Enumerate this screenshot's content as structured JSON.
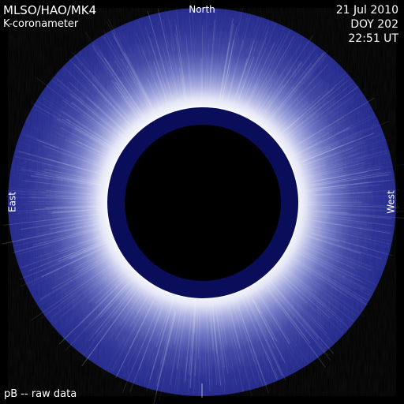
{
  "header": {
    "instrument": "MLSO/HAO/MK4",
    "instrument_type": "K-coronameter",
    "date": "21 Jul 2010",
    "doy": "DOY 202",
    "time": "22:51 UT"
  },
  "orientation": {
    "north": "North",
    "east": "East",
    "west": "West"
  },
  "footer": {
    "caption": "pB -- raw data"
  },
  "colors": {
    "background": "#000000",
    "outer_corona": "#232a8e",
    "bright_corona": "#ffffff",
    "occulter_ring": "#0a0e5a",
    "occulter_core": "#000000",
    "text": "#ffffff"
  }
}
